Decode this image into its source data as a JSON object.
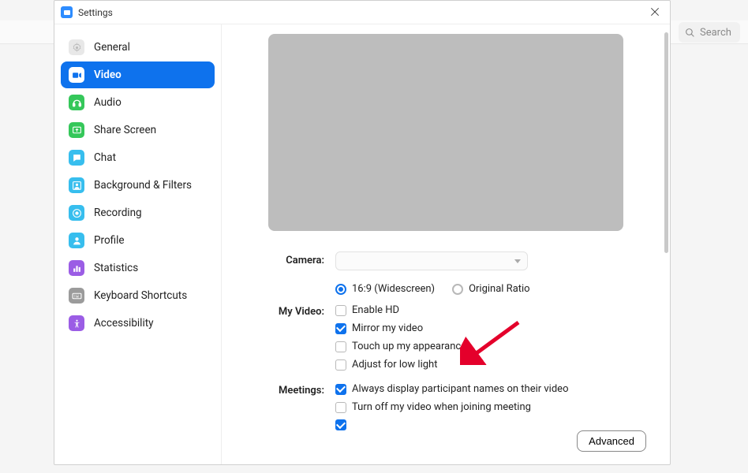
{
  "window": {
    "title": "Settings"
  },
  "search": {
    "placeholder": "Search"
  },
  "sidebar": {
    "items": [
      {
        "label": "General",
        "icon": "gear-icon",
        "bg": "#e8e8e8",
        "fg": "#bbb"
      },
      {
        "label": "Video",
        "icon": "video-icon",
        "bg": "#fff",
        "fg": "#0e72ed"
      },
      {
        "label": "Audio",
        "icon": "audio-icon",
        "bg": "#35c75a",
        "fg": "#fff"
      },
      {
        "label": "Share Screen",
        "icon": "share-icon",
        "bg": "#35c75a",
        "fg": "#fff"
      },
      {
        "label": "Chat",
        "icon": "chat-icon",
        "bg": "#37beee",
        "fg": "#fff"
      },
      {
        "label": "Background & Filters",
        "icon": "background-icon",
        "bg": "#37beee",
        "fg": "#fff"
      },
      {
        "label": "Recording",
        "icon": "recording-icon",
        "bg": "#37beee",
        "fg": "#fff"
      },
      {
        "label": "Profile",
        "icon": "profile-icon",
        "bg": "#37beee",
        "fg": "#fff"
      },
      {
        "label": "Statistics",
        "icon": "statistics-icon",
        "bg": "#9b5de5",
        "fg": "#fff"
      },
      {
        "label": "Keyboard Shortcuts",
        "icon": "keyboard-icon",
        "bg": "#9b9b9b",
        "fg": "#fff"
      },
      {
        "label": "Accessibility",
        "icon": "accessibility-icon",
        "bg": "#9b5de5",
        "fg": "#fff"
      }
    ],
    "active_index": 1
  },
  "content": {
    "camera_label": "Camera:",
    "aspect_169": "16:9 (Widescreen)",
    "aspect_original": "Original Ratio",
    "myvideo_label": "My Video:",
    "enable_hd": "Enable HD",
    "mirror": "Mirror my video",
    "touch_up": "Touch up my appearance",
    "low_light": "Adjust for low light",
    "meetings_label": "Meetings:",
    "display_names": "Always display participant names on their video",
    "turn_off_join": "Turn off my video when joining meeting",
    "advanced": "Advanced"
  }
}
